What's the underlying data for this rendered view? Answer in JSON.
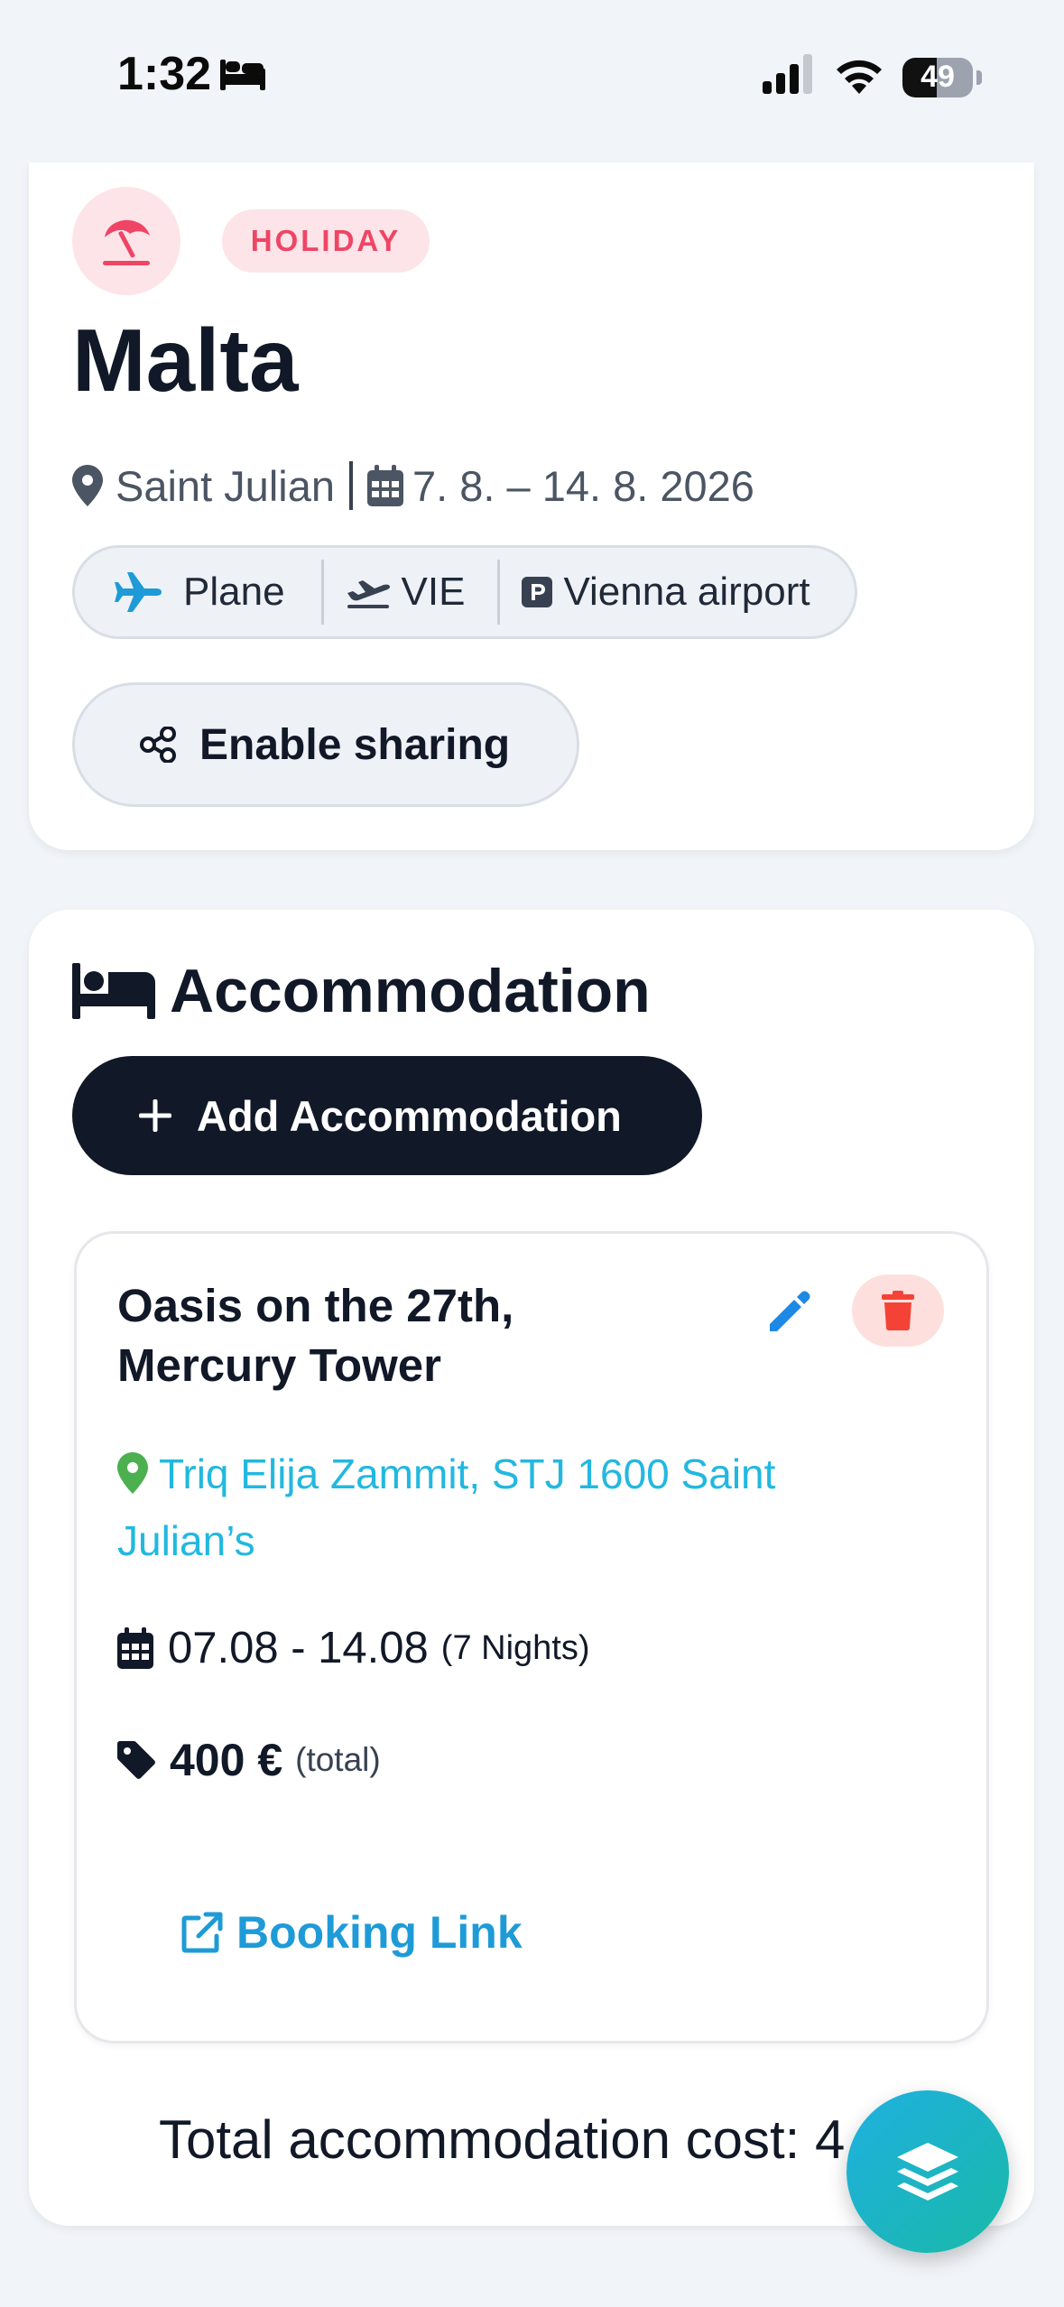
{
  "status_bar": {
    "time": "1:32",
    "battery": "49",
    "battery_level": 0.49
  },
  "trip": {
    "type_badge": "HOLIDAY",
    "type_icon": "beach-umbrella-icon",
    "title": "Malta",
    "location": "Saint Julian",
    "dates": "7. 8. – 14. 8. 2026",
    "transport": {
      "mode": "Plane",
      "airport_code": "VIE",
      "parking": "Vienna airport"
    },
    "share_label": "Enable sharing"
  },
  "accommodation": {
    "section_title": "Accommodation",
    "add_label": "Add Accommodation",
    "items": [
      {
        "name": "Oasis on the 27th, Mercury Tower",
        "address": "Triq Elija Zammit, STJ 1600 Saint Julian’s",
        "dates": "07.08 - 14.08",
        "nights": "(7 Nights)",
        "price": "400 €",
        "price_note": "(total)",
        "link_label": "Booking Link"
      }
    ],
    "total_label": "Total accommodation cost: 4"
  },
  "colors": {
    "accent_pink": "#ef4565",
    "accent_blue": "#22b8e0",
    "dark_button": "#111827",
    "pin_green": "#4caf50",
    "delete_red": "#f44336"
  }
}
